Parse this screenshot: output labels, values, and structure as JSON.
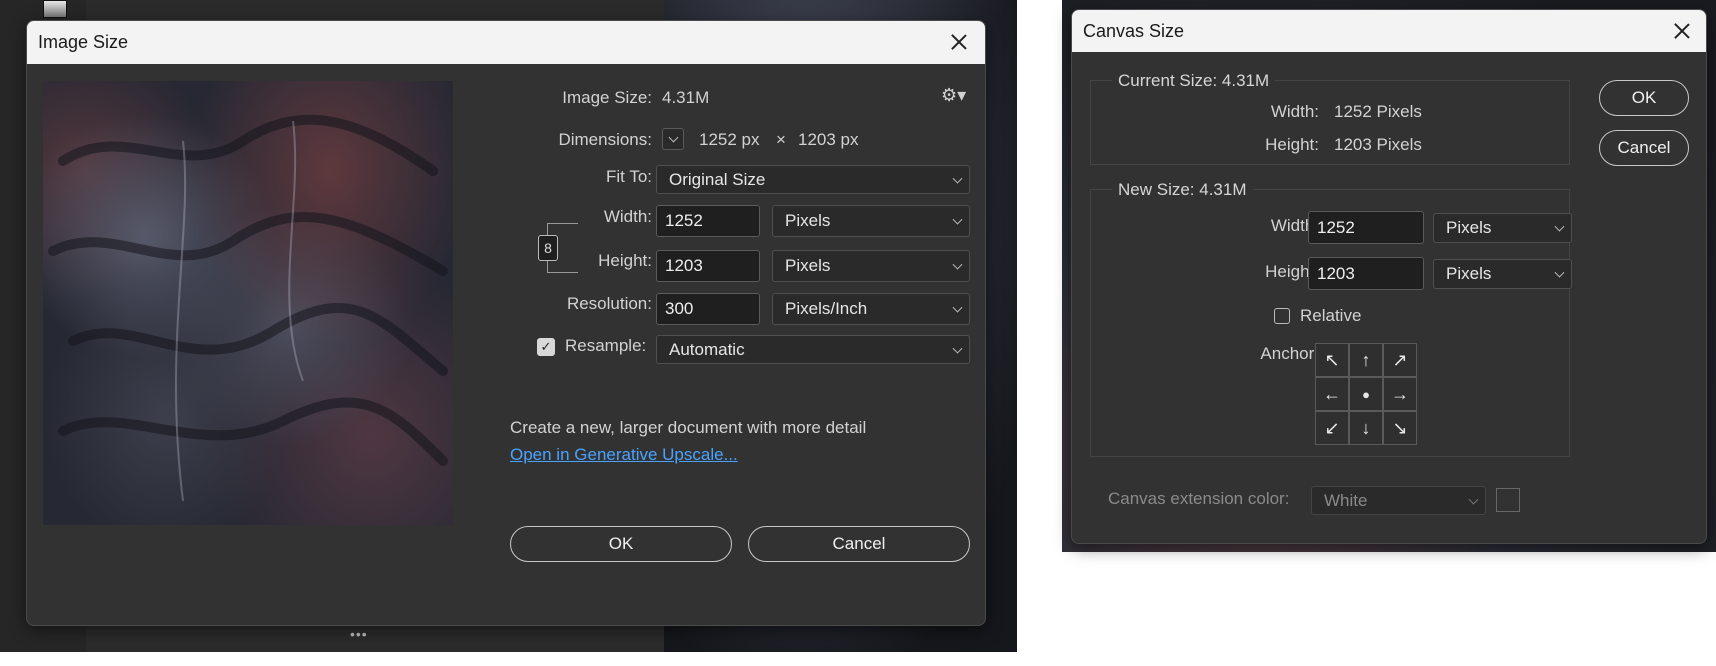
{
  "image_size_dialog": {
    "title": "Image Size",
    "image_size_label": "Image Size:",
    "image_size_value": "4.31M",
    "dimensions_label": "Dimensions:",
    "dim_width": "1252 px",
    "dim_times": "×",
    "dim_height": "1203 px",
    "fit_to_label": "Fit To:",
    "fit_to_value": "Original Size",
    "width_label": "Width:",
    "width_value": "1252",
    "width_unit": "Pixels",
    "height_label": "Height:",
    "height_value": "1203",
    "height_unit": "Pixels",
    "resolution_label": "Resolution:",
    "resolution_value": "300",
    "resolution_unit": "Pixels/Inch",
    "resample_label": "Resample:",
    "resample_checked": true,
    "resample_value": "Automatic",
    "upscale_text": "Create a new, larger document with more detail",
    "upscale_link": "Open in Generative Upscale...",
    "ok_label": "OK",
    "cancel_label": "Cancel"
  },
  "canvas_size_dialog": {
    "title": "Canvas Size",
    "current_size_label": "Current Size: 4.31M",
    "current_width_label": "Width:",
    "current_width_value": "1252 Pixels",
    "current_height_label": "Height:",
    "current_height_value": "1203 Pixels",
    "new_size_label": "New Size: 4.31M",
    "width_label": "Width:",
    "width_value": "1252",
    "width_unit": "Pixels",
    "height_label": "Height:",
    "height_value": "1203",
    "height_unit": "Pixels",
    "relative_label": "Relative",
    "relative_checked": false,
    "anchor_label": "Anchor:",
    "anchor_grid": [
      "arrow-nw",
      "arrow-n",
      "arrow-ne",
      "arrow-w",
      "center-dot",
      "arrow-e",
      "arrow-sw",
      "arrow-s",
      "arrow-se"
    ],
    "anchor_glyphs": [
      "↖",
      "↑",
      "↗",
      "←",
      "●",
      "→",
      "↙",
      "↓",
      "↘"
    ],
    "extension_color_label": "Canvas extension color:",
    "extension_color_value": "White",
    "ok_label": "OK",
    "cancel_label": "Cancel"
  },
  "colors": {
    "link": "#4aa3ff",
    "dialog_bg": "#323232",
    "title_bg": "#f3f3f3"
  }
}
